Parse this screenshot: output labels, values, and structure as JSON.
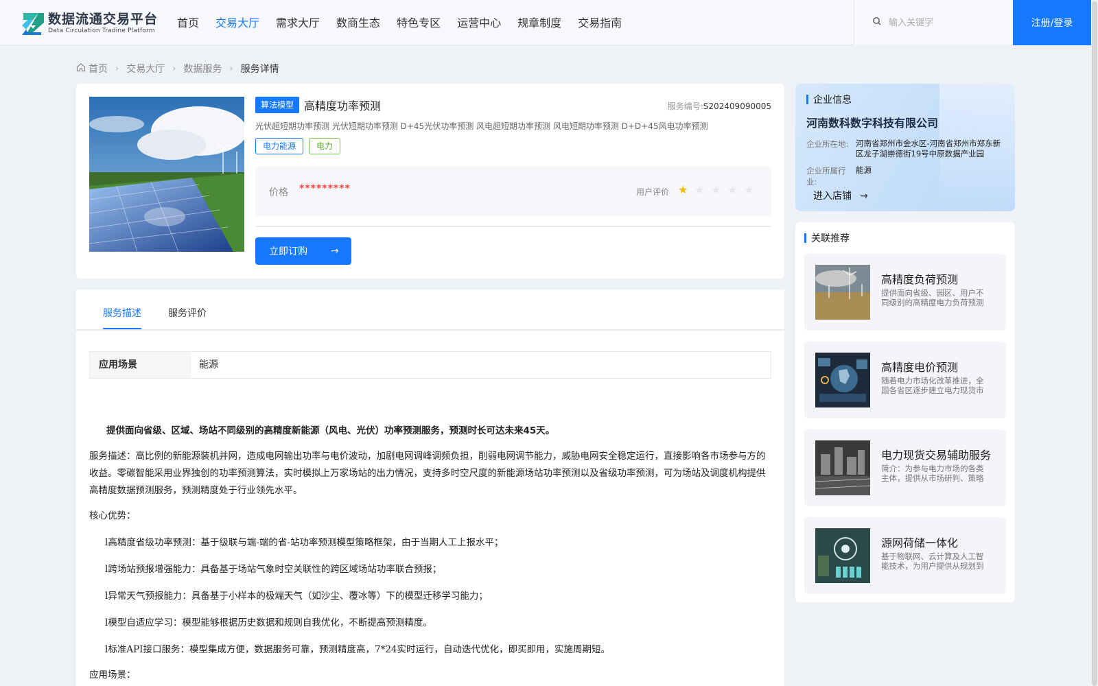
{
  "header": {
    "logo_title": "数据流通交易平台",
    "logo_subtitle": "Data Circulation Tradine Platform",
    "nav": [
      "首页",
      "交易大厅",
      "需求大厅",
      "数商生态",
      "特色专区",
      "运营中心",
      "规章制度",
      "交易指南"
    ],
    "active_nav": "交易大厅",
    "search_placeholder": "输入关键字",
    "login_label": "注册/登录",
    "accent_color": "#1677ff"
  },
  "breadcrumb": [
    "首页",
    "交易大厅",
    "数据服务",
    "服务详情"
  ],
  "product": {
    "type_tag": "算法模型",
    "title": "高精度功率预测",
    "service_no_label": "服务编号:",
    "service_no": "S202409090005",
    "keywords": "光伏超短期功率预测 光伏短期功率预测 D+45光伏功率预测 风电超短期功率预测 风电短期功率预测 D+D+45风电功率预测",
    "tags": [
      "电力能源",
      "电力"
    ],
    "price_label": "价格",
    "price_value": "*********",
    "rating_label": "用户评价",
    "rating": 1,
    "rating_max": 5,
    "buy_label": "立即订购"
  },
  "tabs": [
    "服务描述",
    "服务评价"
  ],
  "active_tab": "服务描述",
  "scene": {
    "key": "应用场景",
    "value": "能源"
  },
  "description": {
    "lead": "提供面向省级、区域、场站不同级别的高精度新能源（风电、光伏）功率预测服务，预测时长可达未来45天。",
    "para": "服务描述：高比例的新能源装机并网，造成电网输出功率与电价波动，加剧电网调峰调频负担，削弱电网调节能力，威胁电网安全稳定运行，直接影响各市场参与方的收益。零碳智能采用业界独创的功率预测算法，实时模拟上万家场站的出力情况，支持多时空尺度的新能源场站功率预测以及省级功率预测，可为场站及调度机构提供高精度数据预测服务，预测精度处于行业领先水平。",
    "advantages_label": "核心优势：",
    "bullets": [
      "l高精度省级功率预测：基于级联与端-端的省-站功率预测模型策略框架，由于当期人工上报水平；",
      "l跨场站预报增强能力：具备基于场站气象时空关联性的跨区域场站功率联合预报；",
      "l异常天气预报能力：具备基于小样本的极端天气（如沙尘、覆冰等）下的模型迁移学习能力；",
      "l模型自适应学习：模型能够根据历史数据和规则自我优化，不断提高预测精度。",
      "l标准API接口服务：模型集成方便，数据服务可靠，预测精度高，7*24实时运行，自动迭代优化，即买即用，实施周期短。"
    ],
    "scenes_label": "应用场景："
  },
  "company": {
    "section_title": "企业信息",
    "name": "河南数科数字科技有限公司",
    "location_label": "企业所在地:",
    "location": "河南省郑州市金水区-河南省郑州市郑东新区龙子湖崇德街19号中原数据产业园",
    "industry_label": "企业所属行业:",
    "industry": "能源",
    "enter_label": "进入店铺"
  },
  "recommend": {
    "section_title": "关联推荐",
    "items": [
      {
        "title": "高精度负荷预测",
        "desc": "提供面向省级、园区、用户不同级别的高精度电力负荷预测服务",
        "image": "wind-turbines"
      },
      {
        "title": "高精度电价预测",
        "desc": "随着电力市场化改革推进，全国各省区逐步建立电力现货市场",
        "image": "globe-dashboard"
      },
      {
        "title": "电力现货交易辅助服务",
        "desc": "简介：为参与电力市场的各类主体，提供从市场研判、策略制定",
        "image": "city-grid"
      },
      {
        "title": "源网荷储一体化",
        "desc": "基于物联网、云计算及人工智能技术，为用户提供从规划到运营",
        "image": "energy-storage"
      }
    ]
  }
}
